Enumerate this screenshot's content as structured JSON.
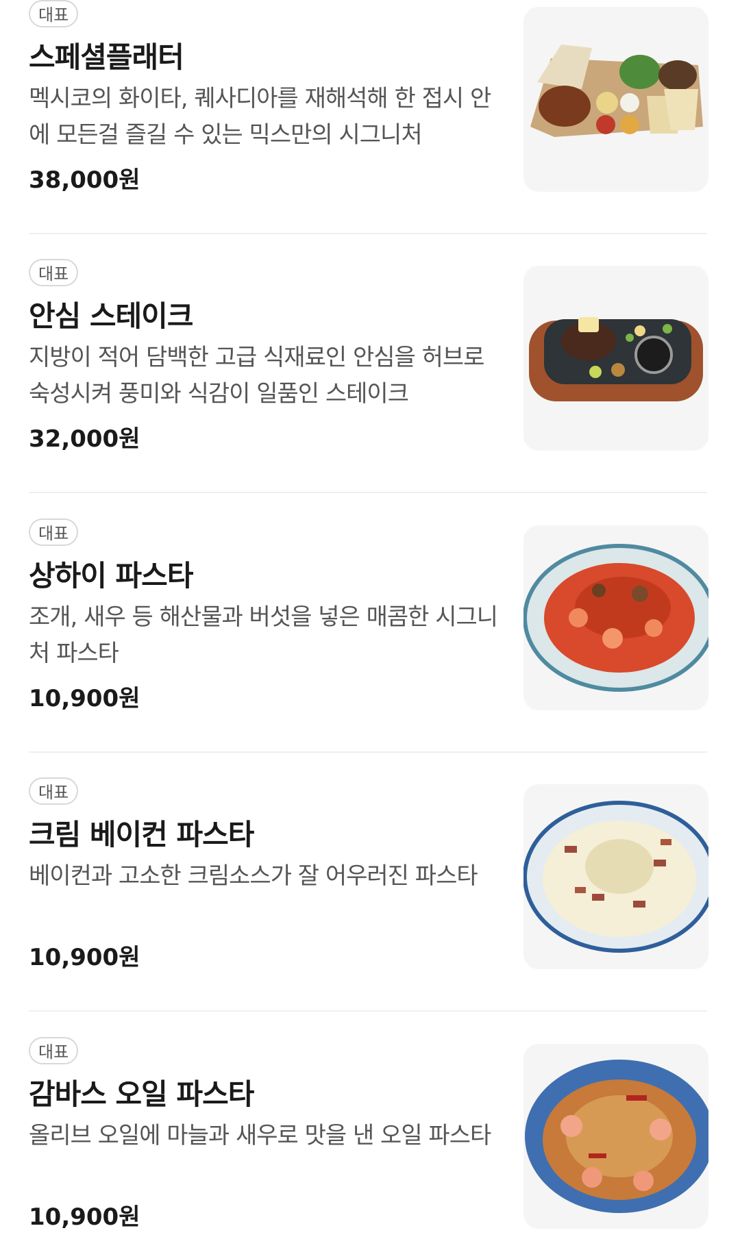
{
  "badge_label": "대표",
  "menu": [
    {
      "name": "스페셜플래터",
      "description": "멕시코의 화이타, 퀘사디아를 재해석해 한 접시 안에 모든걸 즐길 수 있는 믹스만의 시그니처",
      "price": "38,000원",
      "image_icon": "platter-photo-icon"
    },
    {
      "name": "안심 스테이크",
      "description": "지방이 적어 담백한 고급 식재료인 안심을 허브로 숙성시켜 풍미와 식감이 일품인 스테이크",
      "price": "32,000원",
      "image_icon": "steak-photo-icon"
    },
    {
      "name": "상하이 파스타",
      "description": "조개, 새우 등 해산물과 버섯을 넣은 매콤한 시그니처 파스타",
      "price": "10,900원",
      "image_icon": "shanghai-pasta-photo-icon"
    },
    {
      "name": "크림 베이컨 파스타",
      "description": "베이컨과 고소한 크림소스가 잘 어우러진 파스타",
      "price": "10,900원",
      "image_icon": "cream-bacon-pasta-photo-icon"
    },
    {
      "name": "감바스 오일 파스타",
      "description": "올리브 오일에 마늘과 새우로 맛을 낸 오일 파스타",
      "price": "10,900원",
      "image_icon": "gambas-oil-pasta-photo-icon"
    }
  ]
}
